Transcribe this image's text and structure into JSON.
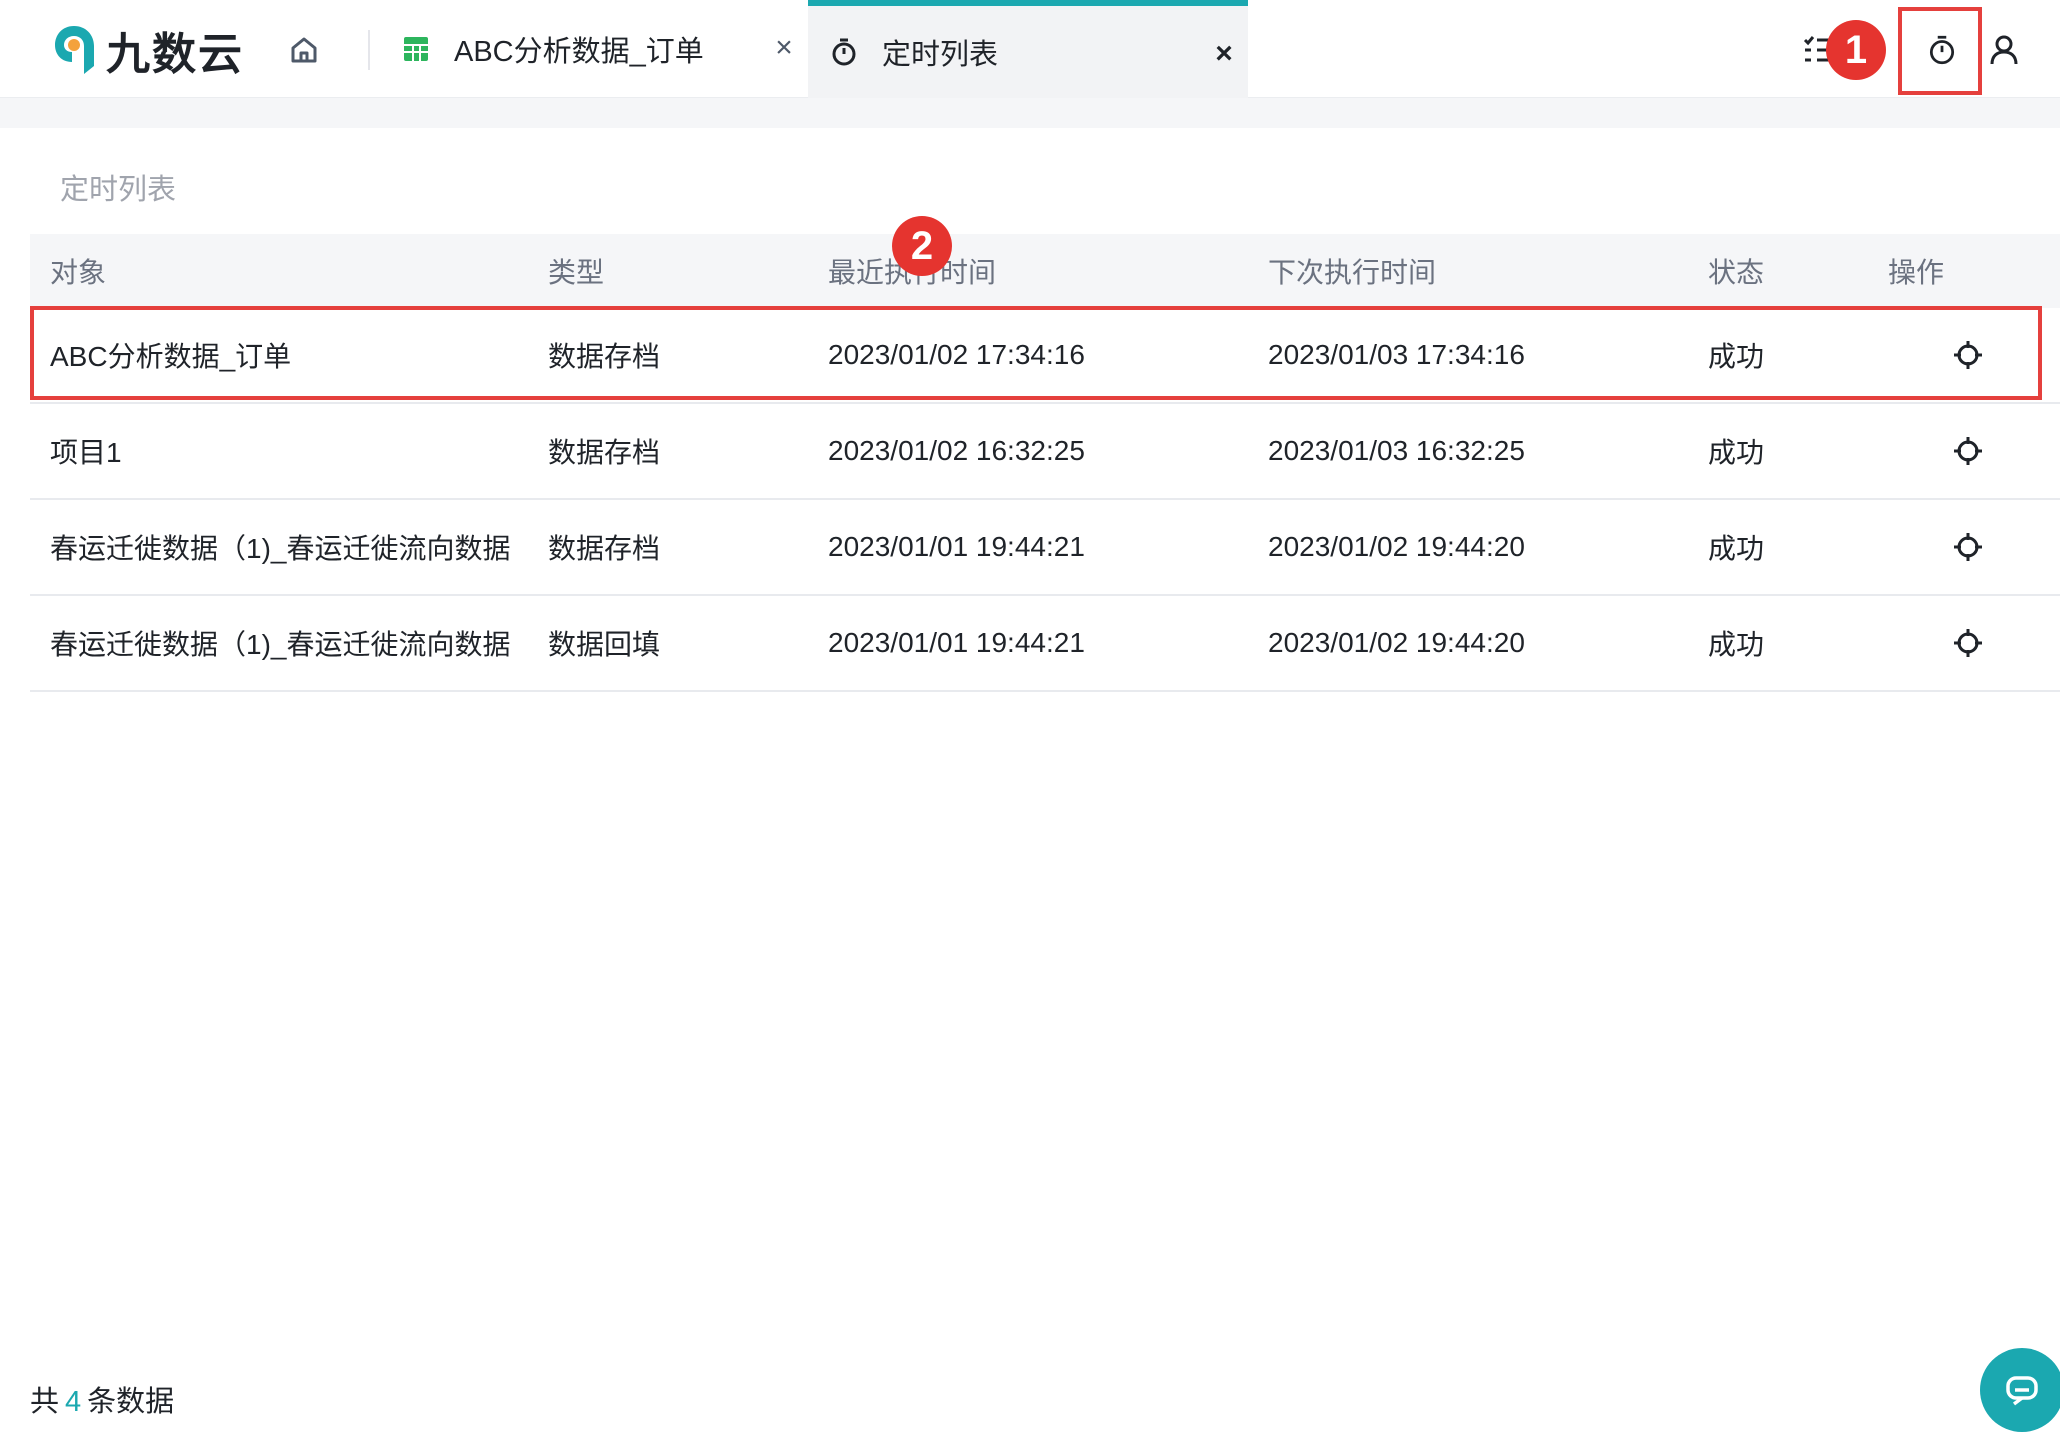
{
  "app": {
    "logo_text": "九数云"
  },
  "tabs": [
    {
      "label": "ABC分析数据_订单",
      "icon": "spreadsheet-icon",
      "icon_color": "#2db55d",
      "close": "×"
    },
    {
      "label": "定时列表",
      "icon": "timer-icon",
      "close": "×",
      "active": true
    }
  ],
  "accent_color": "#1ba8b0",
  "annotation_color": "#e5342f",
  "badges": {
    "one": "1",
    "two": "2"
  },
  "page": {
    "title": "定时列表"
  },
  "table": {
    "headers": [
      "对象",
      "类型",
      "最近执行时间",
      "下次执行时间",
      "状态",
      "操作"
    ],
    "rows": [
      {
        "object": "ABC分析数据_订单",
        "type": "数据存档",
        "last_run": "2023/01/02 17:34:16",
        "next_run": "2023/01/03 17:34:16",
        "status": "成功"
      },
      {
        "object": "项目1",
        "type": "数据存档",
        "last_run": "2023/01/02 16:32:25",
        "next_run": "2023/01/03 16:32:25",
        "status": "成功"
      },
      {
        "object": "春运迁徙数据（1)_春运迁徙流向数据",
        "type": "数据存档",
        "last_run": "2023/01/01 19:44:21",
        "next_run": "2023/01/02 19:44:20",
        "status": "成功"
      },
      {
        "object": "春运迁徙数据（1)_春运迁徙流向数据",
        "type": "数据回填",
        "last_run": "2023/01/01 19:44:21",
        "next_run": "2023/01/02 19:44:20",
        "status": "成功"
      }
    ]
  },
  "footer": {
    "prefix": "共",
    "count": "4",
    "suffix": "条数据"
  }
}
